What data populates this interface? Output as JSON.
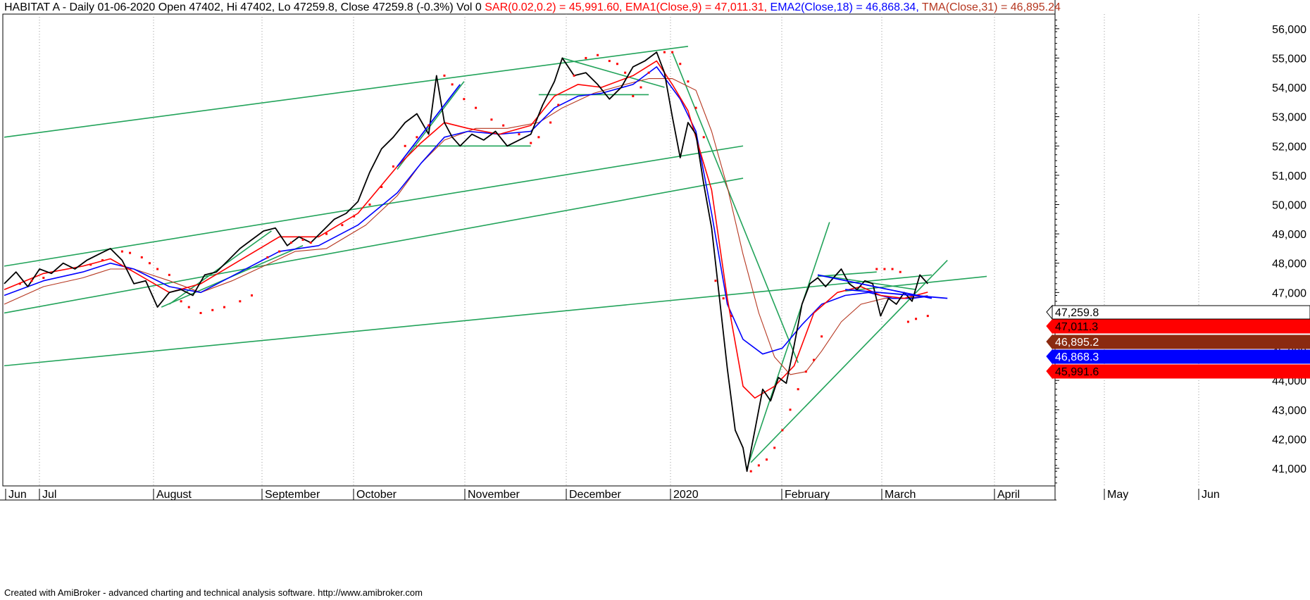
{
  "header": {
    "title": "HABITAT A - Daily 01-06-2020 Open 47402, Hi 47402, Lo 47259.8, Close 47259.8 (-0.3%) Vol 0",
    "sar": "SAR(0.02,0.2) = 45,991.60,",
    "ema1": "EMA1(Close,9) = 47,011.31,",
    "ema2": "EMA2(Close,18) = 46,868.34,",
    "tma": "TMA(Close,31) = 46,895.24"
  },
  "footer": "Created with AmiBroker - advanced charting and technical analysis software. http://www.amibroker.com",
  "chart_data": {
    "type": "line",
    "x_months": [
      "Jun",
      "Jul",
      "August",
      "September",
      "October",
      "November",
      "December",
      "2020",
      "February",
      "March",
      "April",
      "May",
      "Jun"
    ],
    "ylim": [
      40400,
      56500
    ],
    "y_ticks": [
      "56,000",
      "55,000",
      "54,000",
      "53,000",
      "52,000",
      "51,000",
      "50,000",
      "49,000",
      "48,000",
      "47,000",
      "46,000",
      "45,000",
      "44,000",
      "43,000",
      "42,000",
      "41,000"
    ],
    "grid": "vertical dotted at month starts",
    "x_positions_note": "x is trading-day index 0-255, left to right",
    "colors": {
      "close": "#000000",
      "ema1": "#ff0000",
      "ema2": "#0000ff",
      "tma": "#b5361f",
      "sar": "#ff0000",
      "trend": "#22a35a"
    },
    "close_keypoints": [
      [
        0,
        47300
      ],
      [
        3,
        47700
      ],
      [
        6,
        47200
      ],
      [
        9,
        47800
      ],
      [
        12,
        47650
      ],
      [
        15,
        48000
      ],
      [
        18,
        47800
      ],
      [
        21,
        48100
      ],
      [
        24,
        48300
      ],
      [
        27,
        48500
      ],
      [
        30,
        48100
      ],
      [
        33,
        47300
      ],
      [
        36,
        47400
      ],
      [
        39,
        46500
      ],
      [
        42,
        47000
      ],
      [
        45,
        47100
      ],
      [
        48,
        46900
      ],
      [
        51,
        47600
      ],
      [
        54,
        47700
      ],
      [
        57,
        48100
      ],
      [
        60,
        48500
      ],
      [
        63,
        48800
      ],
      [
        66,
        49100
      ],
      [
        69,
        49200
      ],
      [
        72,
        48600
      ],
      [
        75,
        48900
      ],
      [
        78,
        48700
      ],
      [
        81,
        49100
      ],
      [
        84,
        49500
      ],
      [
        87,
        49700
      ],
      [
        90,
        50100
      ],
      [
        93,
        51100
      ],
      [
        96,
        51900
      ],
      [
        99,
        52300
      ],
      [
        102,
        52800
      ],
      [
        105,
        53100
      ],
      [
        108,
        52400
      ],
      [
        110,
        54400
      ],
      [
        112,
        52800
      ],
      [
        114,
        52300
      ],
      [
        116,
        52000
      ],
      [
        119,
        52400
      ],
      [
        122,
        52200
      ],
      [
        125,
        52500
      ],
      [
        128,
        52000
      ],
      [
        131,
        52200
      ],
      [
        134,
        52400
      ],
      [
        137,
        53400
      ],
      [
        140,
        54200
      ],
      [
        142,
        55000
      ],
      [
        145,
        54400
      ],
      [
        148,
        54500
      ],
      [
        151,
        54100
      ],
      [
        154,
        53600
      ],
      [
        157,
        54000
      ],
      [
        160,
        54700
      ],
      [
        163,
        54900
      ],
      [
        166,
        55200
      ],
      [
        168,
        54500
      ],
      [
        170,
        53000
      ],
      [
        172,
        51600
      ],
      [
        174,
        52800
      ],
      [
        176,
        52400
      ],
      [
        178,
        50700
      ],
      [
        180,
        49200
      ],
      [
        182,
        46800
      ],
      [
        184,
        44400
      ],
      [
        186,
        42300
      ],
      [
        188,
        41700
      ],
      [
        189,
        40900
      ],
      [
        191,
        42300
      ],
      [
        193,
        43700
      ],
      [
        195,
        43300
      ],
      [
        197,
        44100
      ],
      [
        199,
        43900
      ],
      [
        201,
        45200
      ],
      [
        203,
        46600
      ],
      [
        205,
        47300
      ],
      [
        207,
        47500
      ],
      [
        209,
        47200
      ],
      [
        211,
        47500
      ],
      [
        213,
        47800
      ],
      [
        215,
        47300
      ],
      [
        217,
        47100
      ],
      [
        219,
        47400
      ],
      [
        221,
        47300
      ],
      [
        223,
        46200
      ],
      [
        225,
        46800
      ],
      [
        227,
        46600
      ],
      [
        229,
        47000
      ],
      [
        231,
        46700
      ],
      [
        233,
        47600
      ],
      [
        235,
        47300
      ]
    ],
    "ema1_keypoints": [
      [
        0,
        47100
      ],
      [
        10,
        47650
      ],
      [
        20,
        47900
      ],
      [
        27,
        48150
      ],
      [
        33,
        47700
      ],
      [
        42,
        47000
      ],
      [
        50,
        47300
      ],
      [
        60,
        48100
      ],
      [
        70,
        48900
      ],
      [
        80,
        48900
      ],
      [
        90,
        49700
      ],
      [
        100,
        51300
      ],
      [
        106,
        52100
      ],
      [
        112,
        52800
      ],
      [
        118,
        52600
      ],
      [
        126,
        52400
      ],
      [
        134,
        52700
      ],
      [
        140,
        53700
      ],
      [
        146,
        54100
      ],
      [
        152,
        54000
      ],
      [
        160,
        54400
      ],
      [
        166,
        54900
      ],
      [
        170,
        54100
      ],
      [
        174,
        53200
      ],
      [
        180,
        50500
      ],
      [
        184,
        46800
      ],
      [
        188,
        43800
      ],
      [
        191,
        43400
      ],
      [
        196,
        43800
      ],
      [
        201,
        44500
      ],
      [
        206,
        46300
      ],
      [
        212,
        47000
      ],
      [
        218,
        47200
      ],
      [
        223,
        46900
      ],
      [
        229,
        46800
      ],
      [
        235,
        47010
      ]
    ],
    "ema2_keypoints": [
      [
        0,
        46900
      ],
      [
        10,
        47400
      ],
      [
        20,
        47700
      ],
      [
        27,
        48000
      ],
      [
        33,
        47800
      ],
      [
        42,
        47200
      ],
      [
        50,
        47000
      ],
      [
        60,
        47700
      ],
      [
        70,
        48400
      ],
      [
        80,
        48600
      ],
      [
        90,
        49300
      ],
      [
        100,
        50400
      ],
      [
        106,
        51400
      ],
      [
        112,
        52300
      ],
      [
        118,
        52500
      ],
      [
        126,
        52400
      ],
      [
        134,
        52500
      ],
      [
        140,
        53300
      ],
      [
        146,
        53700
      ],
      [
        152,
        53800
      ],
      [
        160,
        54100
      ],
      [
        166,
        54700
      ],
      [
        172,
        53600
      ],
      [
        176,
        52500
      ],
      [
        180,
        49700
      ],
      [
        184,
        46600
      ],
      [
        188,
        45400
      ],
      [
        193,
        44900
      ],
      [
        198,
        45100
      ],
      [
        203,
        45900
      ],
      [
        208,
        46600
      ],
      [
        214,
        46900
      ],
      [
        220,
        47000
      ],
      [
        226,
        46800
      ],
      [
        231,
        46800
      ],
      [
        235,
        46870
      ]
    ],
    "tma_keypoints": [
      [
        0,
        46600
      ],
      [
        10,
        47200
      ],
      [
        20,
        47500
      ],
      [
        27,
        47800
      ],
      [
        33,
        47800
      ],
      [
        42,
        47400
      ],
      [
        50,
        47000
      ],
      [
        58,
        47400
      ],
      [
        66,
        47900
      ],
      [
        74,
        48400
      ],
      [
        82,
        48500
      ],
      [
        92,
        49300
      ],
      [
        100,
        50300
      ],
      [
        106,
        51400
      ],
      [
        112,
        52200
      ],
      [
        120,
        52600
      ],
      [
        128,
        52600
      ],
      [
        136,
        52800
      ],
      [
        142,
        53300
      ],
      [
        150,
        53800
      ],
      [
        158,
        54100
      ],
      [
        164,
        54300
      ],
      [
        170,
        54300
      ],
      [
        176,
        53900
      ],
      [
        180,
        52500
      ],
      [
        184,
        50600
      ],
      [
        188,
        48300
      ],
      [
        192,
        46300
      ],
      [
        196,
        44800
      ],
      [
        200,
        44200
      ],
      [
        204,
        44300
      ],
      [
        208,
        45000
      ],
      [
        213,
        46000
      ],
      [
        218,
        46600
      ],
      [
        224,
        46800
      ],
      [
        230,
        46800
      ],
      [
        235,
        46895
      ]
    ],
    "sar_points": [
      [
        4,
        47300
      ],
      [
        7,
        47400
      ],
      [
        10,
        47500
      ],
      [
        22,
        47950
      ],
      [
        25,
        48100
      ],
      [
        30,
        48400
      ],
      [
        32,
        48350
      ],
      [
        35,
        48200
      ],
      [
        37,
        48000
      ],
      [
        39,
        47800
      ],
      [
        42,
        47600
      ],
      [
        45,
        46700
      ],
      [
        47,
        46500
      ],
      [
        50,
        46300
      ],
      [
        53,
        46400
      ],
      [
        56,
        46500
      ],
      [
        60,
        46700
      ],
      [
        63,
        46900
      ],
      [
        67,
        48200
      ],
      [
        70,
        48400
      ],
      [
        73,
        48700
      ],
      [
        76,
        48800
      ],
      [
        78,
        48700
      ],
      [
        82,
        49000
      ],
      [
        86,
        49300
      ],
      [
        89,
        49600
      ],
      [
        93,
        50000
      ],
      [
        96,
        50600
      ],
      [
        99,
        51300
      ],
      [
        102,
        52000
      ],
      [
        105,
        52300
      ],
      [
        108,
        52700
      ],
      [
        112,
        54400
      ],
      [
        114,
        54100
      ],
      [
        117,
        53600
      ],
      [
        120,
        53300
      ],
      [
        124,
        52900
      ],
      [
        127,
        52700
      ],
      [
        131,
        52400
      ],
      [
        134,
        52100
      ],
      [
        136,
        52300
      ],
      [
        139,
        52800
      ],
      [
        141,
        53400
      ],
      [
        145,
        54400
      ],
      [
        148,
        55000
      ],
      [
        151,
        55100
      ],
      [
        154,
        54900
      ],
      [
        156,
        54800
      ],
      [
        158,
        54500
      ],
      [
        160,
        53700
      ],
      [
        162,
        54000
      ],
      [
        164,
        54500
      ],
      [
        168,
        55200
      ],
      [
        170,
        55200
      ],
      [
        172,
        54800
      ],
      [
        174,
        54200
      ],
      [
        176,
        53300
      ],
      [
        178,
        52300
      ],
      [
        181,
        47400
      ],
      [
        183,
        46800
      ],
      [
        185,
        46200
      ],
      [
        190,
        40900
      ],
      [
        192,
        41100
      ],
      [
        194,
        41300
      ],
      [
        196,
        41700
      ],
      [
        198,
        42300
      ],
      [
        200,
        43000
      ],
      [
        202,
        43700
      ],
      [
        204,
        44300
      ],
      [
        206,
        44700
      ],
      [
        208,
        45500
      ],
      [
        222,
        47800
      ],
      [
        224,
        47800
      ],
      [
        226,
        47800
      ],
      [
        228,
        47700
      ],
      [
        230,
        46000
      ],
      [
        232,
        46100
      ],
      [
        235,
        46200
      ]
    ],
    "trendlines": [
      [
        0,
        52300,
        174,
        55400
      ],
      [
        0,
        47900,
        188,
        52000
      ],
      [
        0,
        46300,
        188,
        50900
      ],
      [
        0,
        44500,
        236,
        47600
      ],
      [
        40,
        46500,
        76,
        48600
      ],
      [
        42,
        46600,
        68,
        49100
      ],
      [
        100,
        51200,
        117,
        54200
      ],
      [
        104,
        52000,
        134,
        52000
      ],
      [
        142,
        55000,
        168,
        54000
      ],
      [
        136,
        53750,
        164,
        53750
      ],
      [
        170,
        55200,
        202,
        44600
      ],
      [
        189,
        41000,
        210,
        49400
      ],
      [
        190,
        41200,
        240,
        48100
      ],
      [
        207,
        47600,
        232,
        47100
      ],
      [
        207,
        47550,
        222,
        47700
      ],
      [
        214,
        47050,
        250,
        47550
      ]
    ],
    "blue_lines": [
      [
        100,
        51300,
        116,
        54100
      ],
      [
        207,
        47600,
        236,
        46800
      ],
      [
        214,
        47100,
        240,
        46800
      ]
    ],
    "price_labels": [
      {
        "text": "47,259.8",
        "bg": "#ffffff",
        "fg": "#000000",
        "value": 47259.8
      },
      {
        "text": "47,011.3",
        "bg": "#ff0000",
        "fg": "#000000",
        "value": 47011.3
      },
      {
        "text": "46,895.2",
        "bg": "#8b2a10",
        "fg": "#ffffff",
        "value": 46895.2
      },
      {
        "text": "46,868.3",
        "bg": "#0000ff",
        "fg": "#ffffff",
        "value": 46868.3
      },
      {
        "text": "45,991.6",
        "bg": "#ff0000",
        "fg": "#000000",
        "value": 45991.6
      }
    ]
  }
}
